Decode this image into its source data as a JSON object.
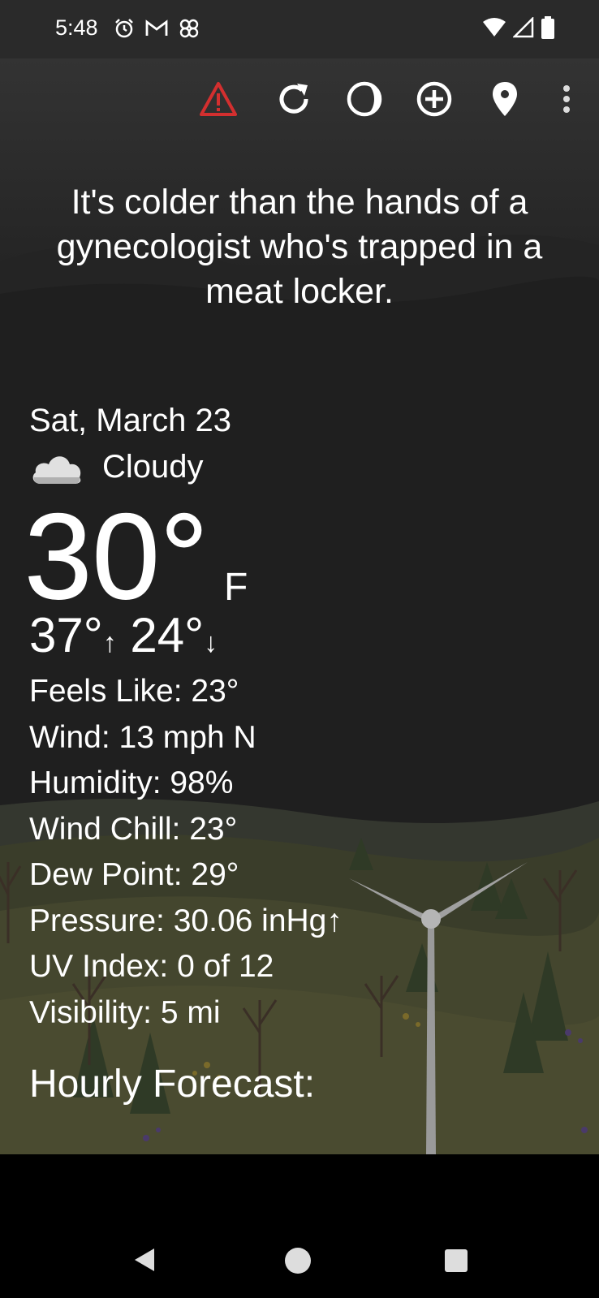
{
  "status": {
    "time": "5:48"
  },
  "quote": "It's colder than the hands of a gynecologist who's trapped in a meat locker.",
  "weather": {
    "date": "Sat, March 23",
    "condition": "Cloudy",
    "temperature": "30°",
    "unit": "F",
    "high": "37°",
    "high_arrow": "↑",
    "low": "24°",
    "low_arrow": "↓",
    "details": [
      "Feels Like:  23°",
      "Wind:  13 mph N",
      "Humidity:  98%",
      "Wind Chill:  23°",
      "Dew Point:  29°",
      "Pressure:  30.06 inHg↑",
      "UV Index:  0 of 12",
      "Visibility:  5 mi"
    ],
    "hourly_title": "Hourly Forecast:"
  },
  "toolbar": {
    "icons": [
      "warning-icon",
      "refresh-icon",
      "theme-icon",
      "add-location-icon",
      "location-pin-icon",
      "more-options-icon"
    ],
    "alert_color": "#d32f2f"
  }
}
